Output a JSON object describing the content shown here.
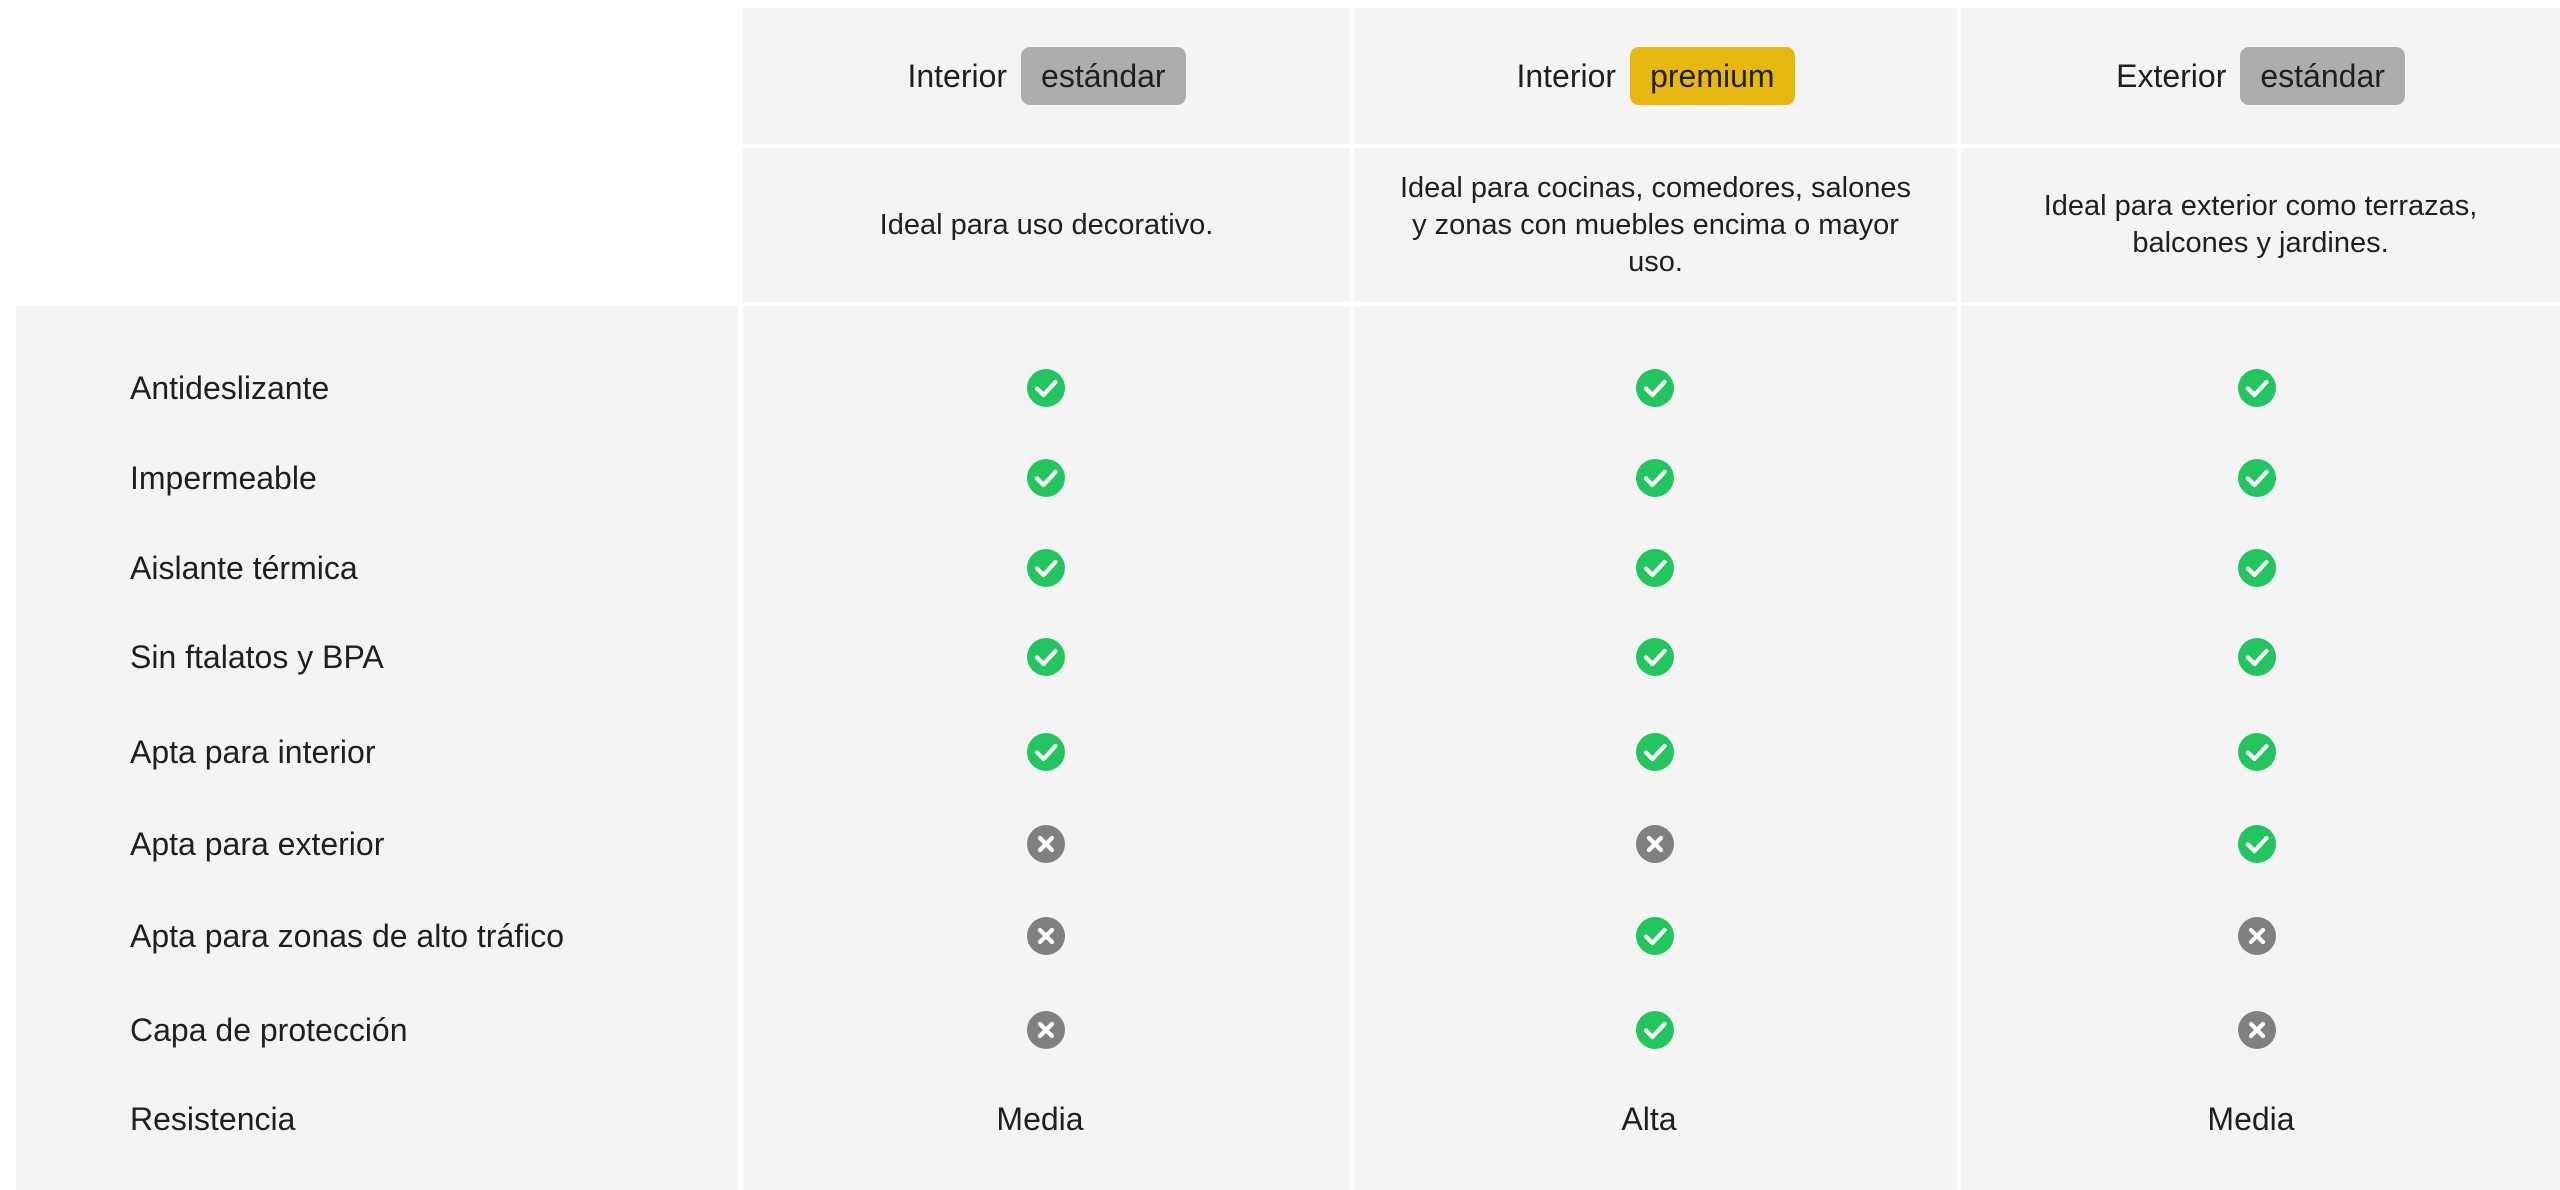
{
  "columns": [
    {
      "prefix": "Interior",
      "tag": "estándar",
      "tag_color": "#adadad",
      "description": "Ideal para uso decorativo."
    },
    {
      "prefix": "Interior",
      "tag": "premium",
      "tag_color": "#e6b70f",
      "description": "Ideal para cocinas, comedores, salones y zonas con muebles encima o mayor uso."
    },
    {
      "prefix": "Exterior",
      "tag": "estándar",
      "tag_color": "#adadad",
      "description": "Ideal para exterior como terrazas, balcones y jardines."
    }
  ],
  "features": [
    {
      "label": "Antideslizante",
      "values": [
        "check",
        "check",
        "check"
      ]
    },
    {
      "label": "Impermeable",
      "values": [
        "check",
        "check",
        "check"
      ]
    },
    {
      "label": "Aislante térmica",
      "values": [
        "check",
        "check",
        "check"
      ]
    },
    {
      "label": "Sin ftalatos y BPA",
      "values": [
        "check",
        "check",
        "check"
      ]
    },
    {
      "label": "Apta para interior",
      "values": [
        "check",
        "check",
        "check"
      ]
    },
    {
      "label": "Apta para exterior",
      "values": [
        "cross",
        "cross",
        "check"
      ]
    },
    {
      "label": "Apta para zonas de alto tráfico",
      "values": [
        "cross",
        "check",
        "cross"
      ]
    },
    {
      "label": "Capa de protección",
      "values": [
        "cross",
        "check",
        "cross"
      ]
    }
  ],
  "resistance": {
    "label": "Resistencia",
    "values": [
      "Media",
      "Alta",
      "Media"
    ]
  },
  "icons": {
    "check": "check-circle-icon",
    "cross": "x-circle-icon"
  },
  "colors": {
    "check": "#22c55e",
    "cross": "#808080",
    "cell_background": "#f4f4f4"
  }
}
